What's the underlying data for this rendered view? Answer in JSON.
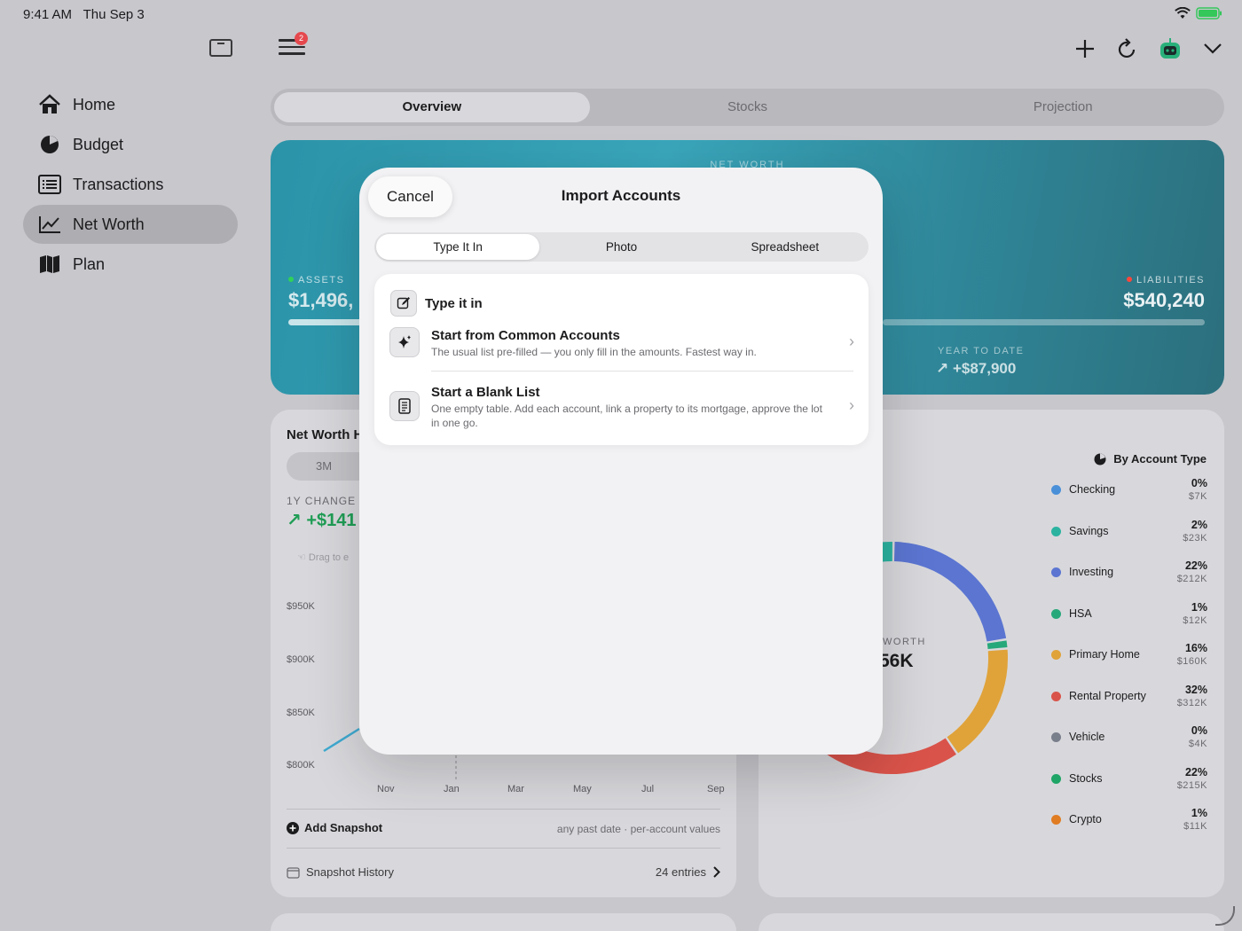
{
  "status": {
    "time": "9:41 AM",
    "date": "Thu Sep 3"
  },
  "sidebar": {
    "items": [
      {
        "label": "Home",
        "icon": "house-icon",
        "active": false
      },
      {
        "label": "Budget",
        "icon": "pie-chart-icon",
        "active": false
      },
      {
        "label": "Transactions",
        "icon": "list-icon",
        "active": false
      },
      {
        "label": "Net Worth",
        "icon": "line-chart-icon",
        "active": true
      },
      {
        "label": "Plan",
        "icon": "map-icon",
        "active": false
      }
    ]
  },
  "topbar": {
    "menu_badge": "2"
  },
  "tabs": [
    {
      "label": "Overview",
      "active": true
    },
    {
      "label": "Stocks",
      "active": false
    },
    {
      "label": "Projection",
      "active": false
    }
  ],
  "hero": {
    "label": "NET WORTH",
    "assets_label": "ASSETS",
    "assets_value": "$1,496,",
    "liabilities_label": "LIABILITIES",
    "liabilities_value": "$540,240",
    "ytd_label": "YEAR TO DATE",
    "ytd_value": "↗ +$87,900"
  },
  "history_card": {
    "title": "Net Worth H",
    "range": "3M",
    "change_label": "1Y CHANGE",
    "change_value": "↗ +$141",
    "drag_hint": "Drag to e",
    "y_ticks": [
      "$950K",
      "$900K",
      "$850K",
      "$800K"
    ],
    "x_ticks": [
      "Nov",
      "Jan",
      "Mar",
      "May",
      "Jul",
      "Sep"
    ],
    "add_snapshot": "Add Snapshot",
    "add_snapshot_note": "any past date · per-account values",
    "snapshot_history": "Snapshot History",
    "snapshot_count": "24 entries"
  },
  "breakdown_card": {
    "by_type": "By Account Type",
    "center_label": "WORTH",
    "center_value": "56K",
    "legend": [
      {
        "name": "Checking",
        "pct": "0%",
        "amount": "$7K",
        "color": "#4a90d9"
      },
      {
        "name": "Savings",
        "pct": "2%",
        "amount": "$23K",
        "color": "#2bb3a0"
      },
      {
        "name": "Investing",
        "pct": "22%",
        "amount": "$212K",
        "color": "#5b75d1"
      },
      {
        "name": "HSA",
        "pct": "1%",
        "amount": "$12K",
        "color": "#27a87a"
      },
      {
        "name": "Primary Home",
        "pct": "16%",
        "amount": "$160K",
        "color": "#e0a33a"
      },
      {
        "name": "Rental Property",
        "pct": "32%",
        "amount": "$312K",
        "color": "#d9534a"
      },
      {
        "name": "Vehicle",
        "pct": "0%",
        "amount": "$4K",
        "color": "#7a7f8c"
      },
      {
        "name": "Stocks",
        "pct": "22%",
        "amount": "$215K",
        "color": "#1fa567"
      },
      {
        "name": "Crypto",
        "pct": "1%",
        "amount": "$11K",
        "color": "#e07c22"
      }
    ]
  },
  "modal": {
    "cancel": "Cancel",
    "title": "Import Accounts",
    "tabs": [
      {
        "label": "Type It In",
        "active": true
      },
      {
        "label": "Photo",
        "active": false
      },
      {
        "label": "Spreadsheet",
        "active": false
      }
    ],
    "section_title": "Type it in",
    "options": [
      {
        "title": "Start from Common Accounts",
        "desc": "The usual list pre-filled — you only fill in the amounts. Fastest way in."
      },
      {
        "title": "Start a Blank List",
        "desc": "One empty table. Add each account, link a property to its mortgage, approve the lot in one go."
      }
    ]
  }
}
